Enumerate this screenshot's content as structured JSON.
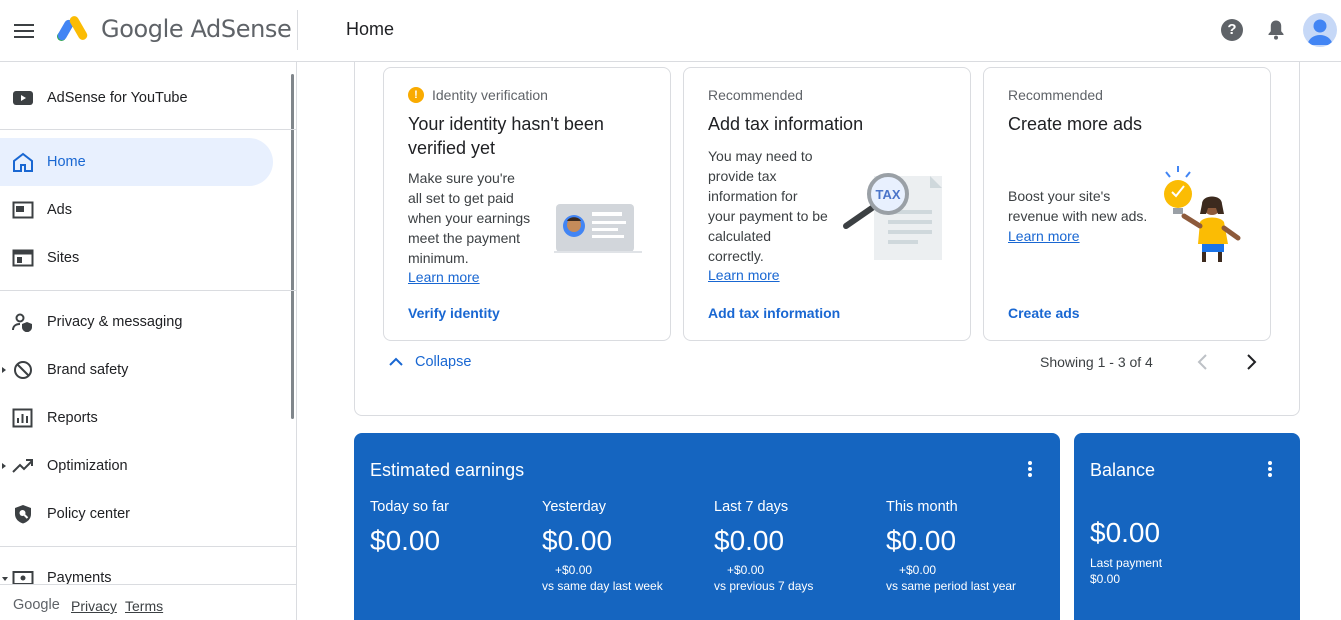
{
  "header": {
    "app_name": "Google AdSense",
    "page_title": "Home",
    "help_glyph": "?",
    "icons": [
      "menu-icon",
      "adsense-logo",
      "help-icon",
      "bell-icon",
      "account-avatar"
    ]
  },
  "sidebar": {
    "items": [
      {
        "label": "AdSense for YouTube",
        "icon": "youtube-icon"
      },
      {
        "label": "Home",
        "icon": "home-icon",
        "active": true
      },
      {
        "label": "Ads",
        "icon": "ads-icon"
      },
      {
        "label": "Sites",
        "icon": "sites-icon"
      },
      {
        "label": "Privacy & messaging",
        "icon": "privacy-icon"
      },
      {
        "label": "Brand safety",
        "icon": "block-icon",
        "expandable": true
      },
      {
        "label": "Reports",
        "icon": "reports-icon"
      },
      {
        "label": "Optimization",
        "icon": "trending-icon",
        "expandable": true
      },
      {
        "label": "Policy center",
        "icon": "shield-icon"
      },
      {
        "label": "Payments",
        "icon": "payments-icon",
        "expandable": true
      }
    ],
    "footer": {
      "brand": "Google",
      "privacy": "Privacy",
      "terms": "Terms"
    }
  },
  "recommendations": {
    "cards": [
      {
        "kicker": "Identity verification",
        "warn_glyph": "!",
        "title": "Your identity hasn't been verified yet",
        "body": [
          "Make sure you're",
          "all set to get paid",
          "when your earnings",
          "meet the payment",
          "minimum."
        ],
        "learn": "Learn more",
        "action": "Verify identity"
      },
      {
        "kicker": "Recommended",
        "title": "Add tax information",
        "body": [
          "You may need to",
          "provide tax",
          "information for",
          "your payment to be",
          "calculated",
          "correctly."
        ],
        "learn": "Learn more",
        "action": "Add tax information",
        "badge": "TAX"
      },
      {
        "kicker": "Recommended",
        "title": "Create more ads",
        "body": [
          "Boost your site's",
          "revenue with new ads."
        ],
        "learn": "Learn more",
        "action": "Create ads"
      }
    ],
    "collapse_label": "Collapse",
    "showing": "Showing 1 - 3 of 4"
  },
  "earnings": {
    "title": "Estimated earnings",
    "metrics": [
      {
        "label": "Today so far",
        "value": "$0.00",
        "delta": "",
        "compare": ""
      },
      {
        "label": "Yesterday",
        "value": "$0.00",
        "delta": "+$0.00",
        "compare": "vs same day last week"
      },
      {
        "label": "Last 7 days",
        "value": "$0.00",
        "delta": "+$0.00",
        "compare": "vs previous 7 days"
      },
      {
        "label": "This month",
        "value": "$0.00",
        "delta": "+$0.00",
        "compare": "vs same period last year"
      }
    ]
  },
  "balance": {
    "title": "Balance",
    "value": "$0.00",
    "last_payment_label": "Last payment",
    "last_payment_value": "$0.00"
  },
  "colors": {
    "accent": "#1967d2",
    "card_blue": "#1565c0",
    "active_nav_bg": "#e8f0fe",
    "warn": "#f9ab00"
  }
}
